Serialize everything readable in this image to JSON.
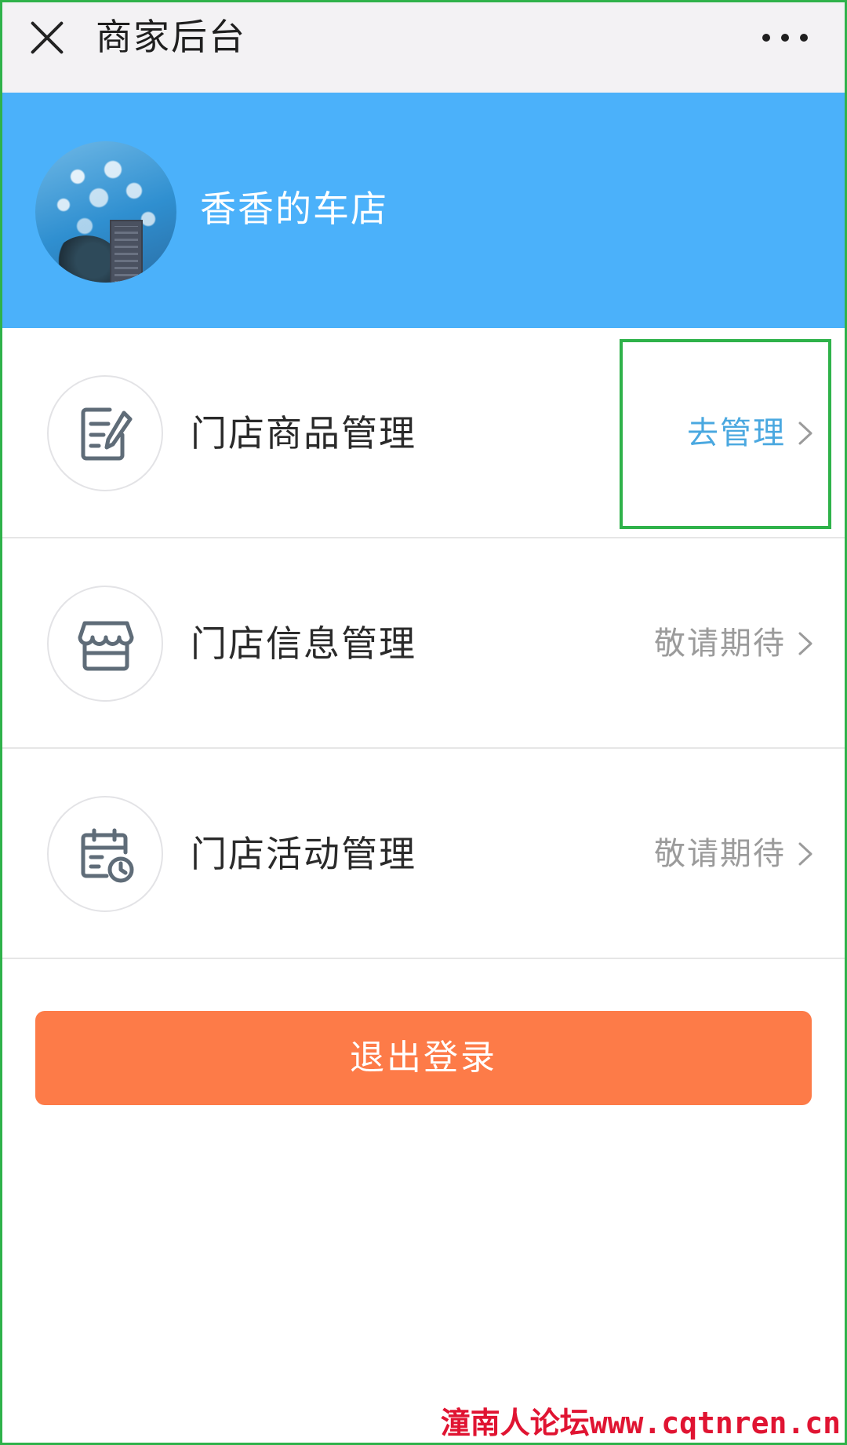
{
  "titlebar": {
    "title": "商家后台",
    "close_icon": "close-icon",
    "more_icon": "more-dots-icon"
  },
  "header": {
    "shop_name": "香香的车店",
    "background_color": "#4bb1fa",
    "avatar_icon": "avatar-sky-photo"
  },
  "menu": {
    "items": [
      {
        "label": "门店商品管理",
        "action": "去管理",
        "action_color": "#4aa8e0",
        "icon": "edit-document-icon"
      },
      {
        "label": "门店信息管理",
        "action": "敬请期待",
        "action_color": "#9b9b9b",
        "icon": "store-icon"
      },
      {
        "label": "门店活动管理",
        "action": "敬请期待",
        "action_color": "#9b9b9b",
        "icon": "calendar-clock-icon"
      }
    ]
  },
  "logout": {
    "label": "退出登录",
    "color": "#fd7b48"
  },
  "watermark": {
    "text": "潼南人论坛www.cqtnren.cn",
    "color": "#e01432"
  },
  "annotation": {
    "highlight_color": "#2fb24a"
  }
}
